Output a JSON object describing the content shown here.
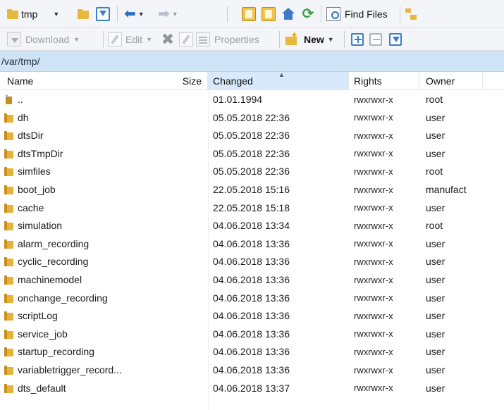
{
  "toolbar_top": {
    "location_label": "tmp",
    "find_files_label": "Find Files"
  },
  "toolbar_actions": {
    "download_label": "Download",
    "edit_label": "Edit",
    "properties_label": "Properties",
    "new_label": "New"
  },
  "path": "/var/tmp/",
  "columns": {
    "name": "Name",
    "size": "Size",
    "changed": "Changed",
    "rights": "Rights",
    "owner": "Owner"
  },
  "sort_column": "changed",
  "files": [
    {
      "name": "..",
      "changed": "01.01.1994",
      "rights": "rwxrwxr-x",
      "owner": "root",
      "kind": "parent"
    },
    {
      "name": "dh",
      "changed": "05.05.2018 22:36",
      "rights": "rwxrwxr-x",
      "owner": "user",
      "kind": "folder"
    },
    {
      "name": "dtsDir",
      "changed": "05.05.2018 22:36",
      "rights": "rwxrwxr-x",
      "owner": "user",
      "kind": "folder"
    },
    {
      "name": "dtsTmpDir",
      "changed": "05.05.2018 22:36",
      "rights": "rwxrwxr-x",
      "owner": "user",
      "kind": "folder"
    },
    {
      "name": "simfiles",
      "changed": "05.05.2018 22:36",
      "rights": "rwxrwxr-x",
      "owner": "root",
      "kind": "folder"
    },
    {
      "name": "boot_job",
      "changed": "22.05.2018 15:16",
      "rights": "rwxrwxr-x",
      "owner": "manufact",
      "kind": "folder"
    },
    {
      "name": "cache",
      "changed": "22.05.2018 15:18",
      "rights": "rwxrwxr-x",
      "owner": "user",
      "kind": "folder"
    },
    {
      "name": "simulation",
      "changed": "04.06.2018 13:34",
      "rights": "rwxrwxr-x",
      "owner": "root",
      "kind": "folder"
    },
    {
      "name": "alarm_recording",
      "changed": "04.06.2018 13:36",
      "rights": "rwxrwxr-x",
      "owner": "user",
      "kind": "folder"
    },
    {
      "name": "cyclic_recording",
      "changed": "04.06.2018 13:36",
      "rights": "rwxrwxr-x",
      "owner": "user",
      "kind": "folder"
    },
    {
      "name": "machinemodel",
      "changed": "04.06.2018 13:36",
      "rights": "rwxrwxr-x",
      "owner": "user",
      "kind": "folder"
    },
    {
      "name": "onchange_recording",
      "changed": "04.06.2018 13:36",
      "rights": "rwxrwxr-x",
      "owner": "user",
      "kind": "folder"
    },
    {
      "name": "scriptLog",
      "changed": "04.06.2018 13:36",
      "rights": "rwxrwxr-x",
      "owner": "user",
      "kind": "folder"
    },
    {
      "name": "service_job",
      "changed": "04.06.2018 13:36",
      "rights": "rwxrwxr-x",
      "owner": "user",
      "kind": "folder"
    },
    {
      "name": "startup_recording",
      "changed": "04.06.2018 13:36",
      "rights": "rwxrwxr-x",
      "owner": "user",
      "kind": "folder"
    },
    {
      "name": "variabletrigger_record...",
      "changed": "04.06.2018 13:36",
      "rights": "rwxrwxr-x",
      "owner": "user",
      "kind": "folder"
    },
    {
      "name": "dts_default",
      "changed": "04.06.2018 13:37",
      "rights": "rwxrwxr-x",
      "owner": "user",
      "kind": "folder"
    }
  ]
}
